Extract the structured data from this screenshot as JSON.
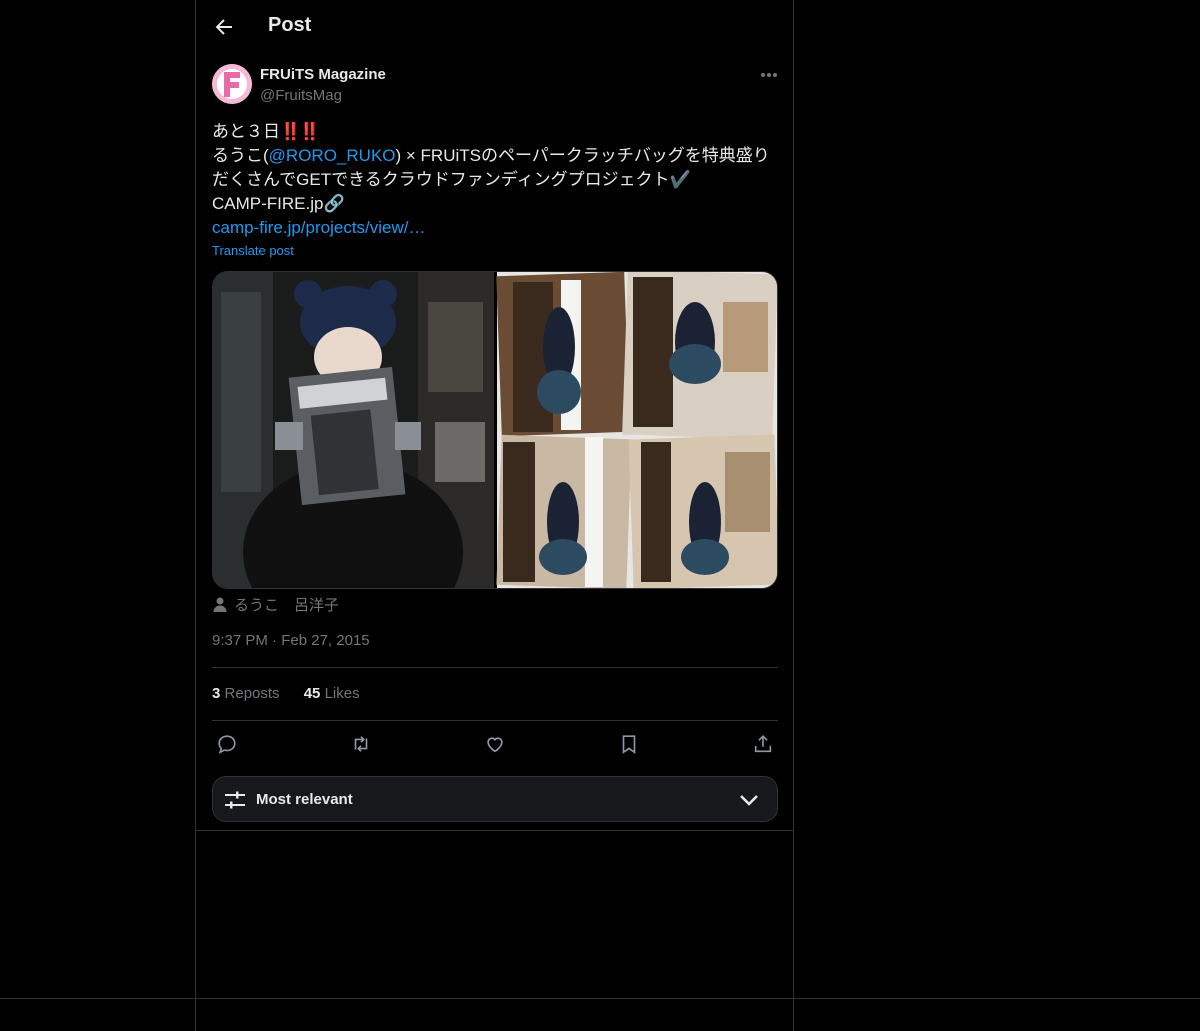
{
  "header": {
    "title": "Post"
  },
  "author": {
    "display_name": "FRUiTS Magazine",
    "handle": "@FruitsMag",
    "avatar_letter": "F"
  },
  "post": {
    "line1_text": "あと３日",
    "line1_emoji": "‼️‼️",
    "line2_pre": "るうこ(",
    "line2_mention": "@RORO_RUKO",
    "line2_post": ") × FRUiTSのペーパークラッチバッグを特典盛り",
    "line3_text": "だくさんでGETできるクラウドファンディングプロジェクト",
    "line3_emoji": "✔️",
    "line4_text": "CAMP-FIRE.jp",
    "line4_emoji": "🔗",
    "link_text": "camp-fire.jp/projects/view/…",
    "translate_label": "Translate post"
  },
  "media_tags": {
    "names": "るうこ　呂洋子"
  },
  "timestamp": {
    "time": "9:37 PM",
    "separator": "·",
    "date": "Feb 27, 2015"
  },
  "stats": {
    "reposts_count": "3",
    "reposts_label": "Reposts",
    "likes_count": "45",
    "likes_label": "Likes"
  },
  "actions": {
    "icons": [
      "reply-icon",
      "repost-icon",
      "like-icon",
      "bookmark-icon",
      "share-icon"
    ]
  },
  "replies_sort": {
    "label": "Most relevant"
  },
  "colors": {
    "background": "#000000",
    "text": "#e7e9ea",
    "muted": "#71767b",
    "link": "#1d9bf0",
    "border": "#2f3336"
  }
}
